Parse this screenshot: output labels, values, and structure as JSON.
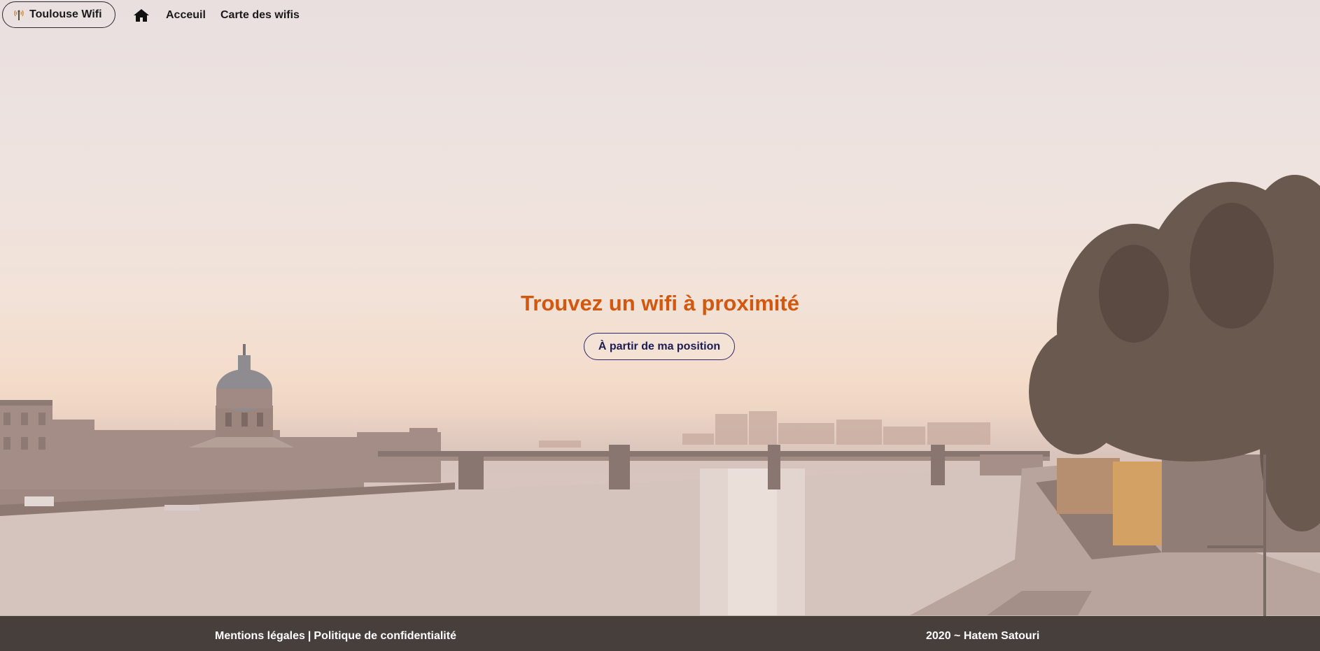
{
  "navbar": {
    "brand_label": "Toulouse Wifi",
    "home_icon": "home-icon",
    "brand_icon": "wifi-tower-icon",
    "links": {
      "accueil": "Acceuil",
      "carte": "Carte des wifis"
    }
  },
  "hero": {
    "title": "Trouvez un wifi à proximité",
    "button_label": "À partir de ma position"
  },
  "footer": {
    "mentions": "Mentions légales",
    "separator": "|",
    "politique": "Politique de confidentialité",
    "credit": "2020 ~ Hatem Satouri"
  },
  "colors": {
    "title": "#d2570f",
    "button_text": "#1d1d55",
    "footer_bg": "#342d2b"
  }
}
